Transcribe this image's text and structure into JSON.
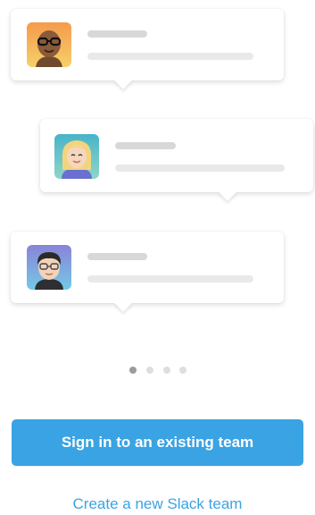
{
  "messages": [
    {
      "avatar_icon": "man-with-glasses-avatar-icon",
      "avatar_bg": "#f2a65a"
    },
    {
      "avatar_icon": "blonde-woman-avatar-icon",
      "avatar_bg": "#5ab7c9"
    },
    {
      "avatar_icon": "man-dark-hair-avatar-icon",
      "avatar_bg": "#8a8fdb"
    }
  ],
  "pagination": {
    "total": 4,
    "active_index": 0
  },
  "actions": {
    "sign_in_label": "Sign in to an existing team",
    "create_label": "Create a new Slack team"
  },
  "colors": {
    "accent": "#3aa3e3",
    "placeholder_line": "#e9e9ea",
    "dot_active": "#9b9b9c",
    "dot_inactive": "#dededf"
  }
}
